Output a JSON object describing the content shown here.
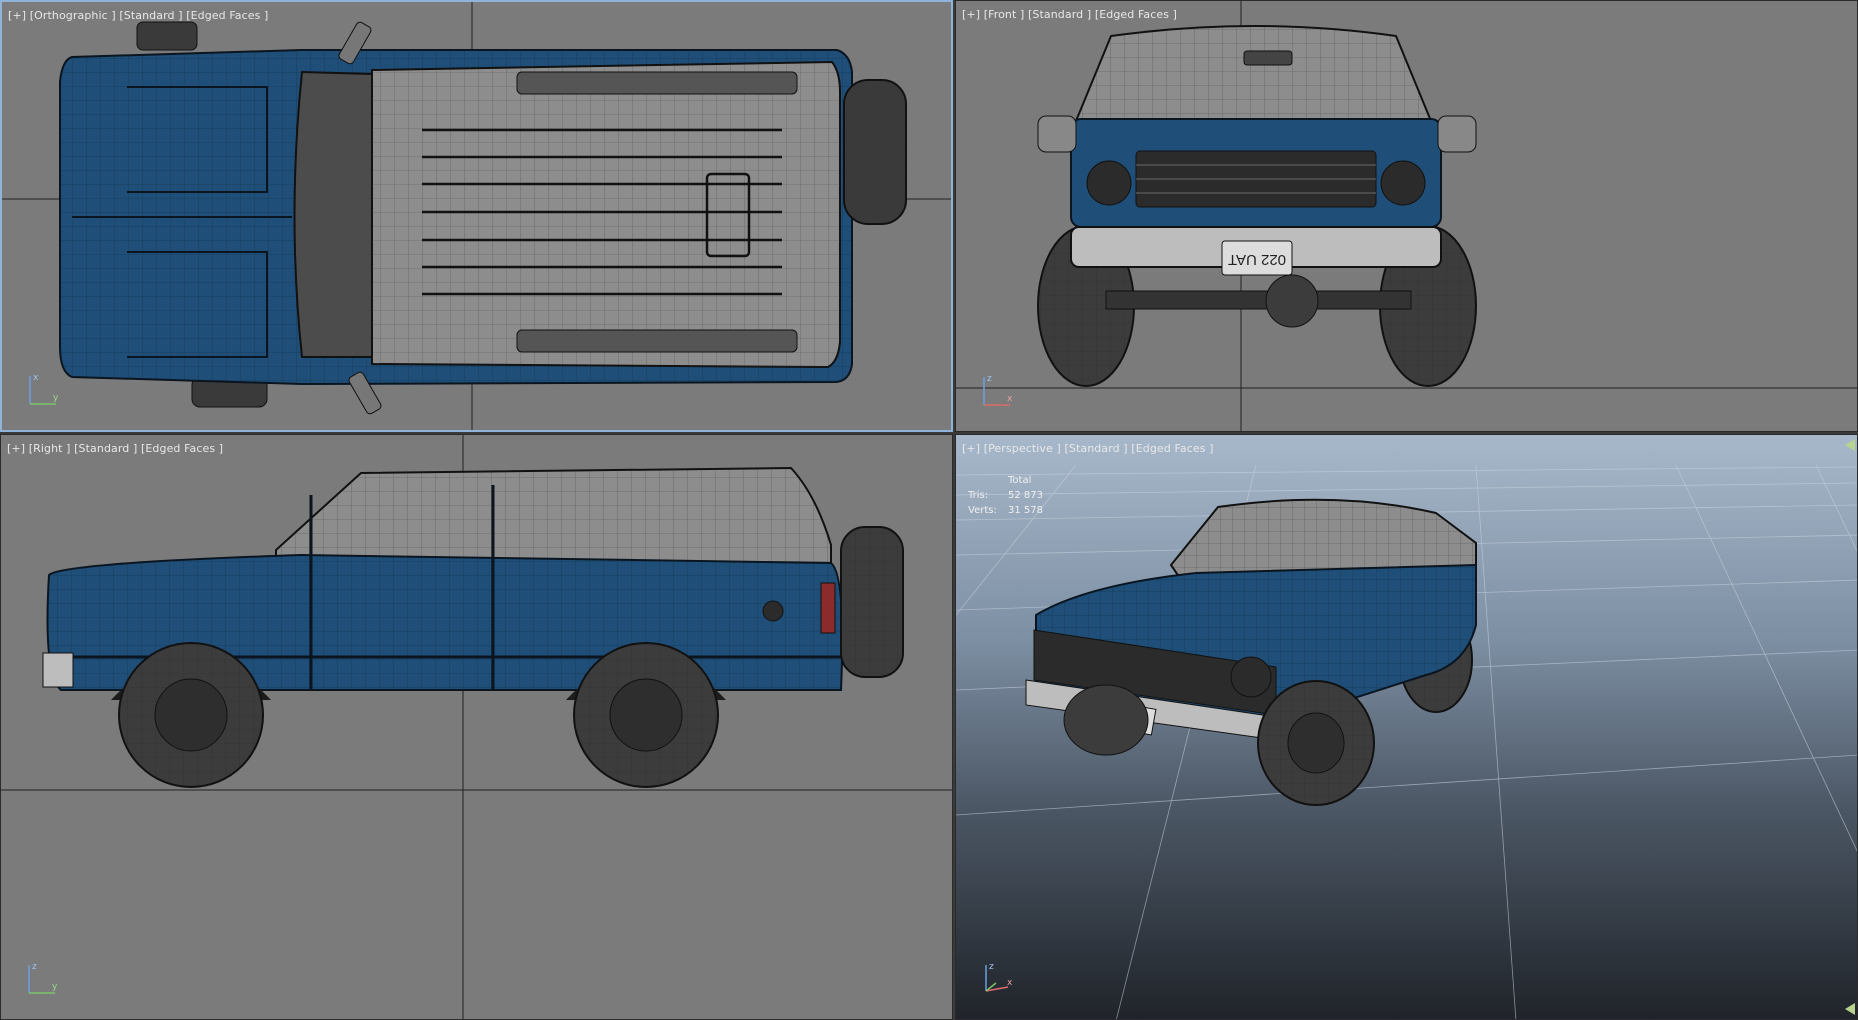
{
  "viewports": {
    "top": {
      "label": "[+] [Orthographic ] [Standard ] [Edged Faces ]",
      "axis": {
        "a": "x",
        "b": "y"
      }
    },
    "front": {
      "label": "[+] [Front ] [Standard ] [Edged Faces ]",
      "axis": {
        "a": "z",
        "b": "x"
      }
    },
    "right": {
      "label": "[+] [Right ] [Standard ] [Edged Faces ]",
      "axis": {
        "a": "z",
        "b": "y"
      }
    },
    "perspective": {
      "label": "[+] [Perspective ] [Standard ] [Edged Faces ]",
      "stats": {
        "header": "Total",
        "tris_label": "Tris:",
        "tris": "52 873",
        "verts_label": "Verts:",
        "verts": "31 578"
      },
      "axis": {
        "a": "z",
        "b": "x"
      }
    }
  },
  "plate_text": "022 UAT",
  "colors": {
    "body_blue": "#1f4f78",
    "body_dark": "#163a59",
    "glass": "#8d8d8d",
    "tire": "#3a3a3a",
    "chrome": "#bdbdbd",
    "viewport_bg": "#7b7b7b",
    "active_border": "#8fb3d9"
  },
  "icons": {
    "axis": "axis-gizmo-icon",
    "viewport_menu": "plus-icon"
  }
}
